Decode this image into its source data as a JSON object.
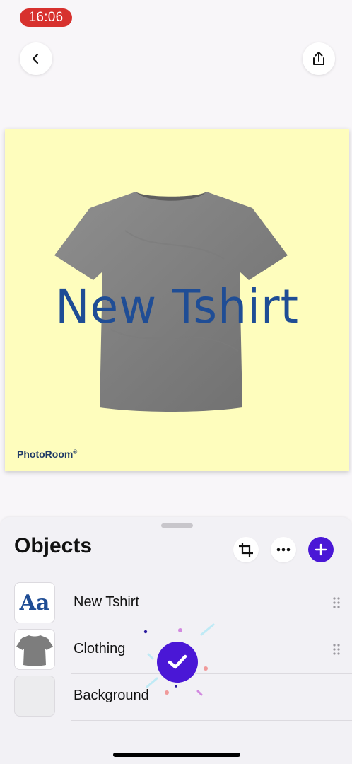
{
  "status_bar": {
    "time": "16:06"
  },
  "top_bar": {
    "back_icon": "chevron-left-icon",
    "share_icon": "share-icon"
  },
  "canvas": {
    "background_color": "#fefdbd",
    "text": "New Tshirt",
    "text_color": "#1f4d95",
    "watermark": "PhotoRoom",
    "watermark_mark": "®"
  },
  "objects_panel": {
    "title": "Objects",
    "actions": {
      "crop_icon": "crop-icon",
      "more_icon": "more-icon",
      "add_icon": "plus-icon"
    },
    "accent_color": "#4a17d6",
    "items": [
      {
        "label": "New Tshirt",
        "thumbnail_text": "Aa"
      },
      {
        "label": "Clothing"
      },
      {
        "label": "Background"
      }
    ]
  },
  "overlay": {
    "success_icon": "checkmark-icon"
  }
}
